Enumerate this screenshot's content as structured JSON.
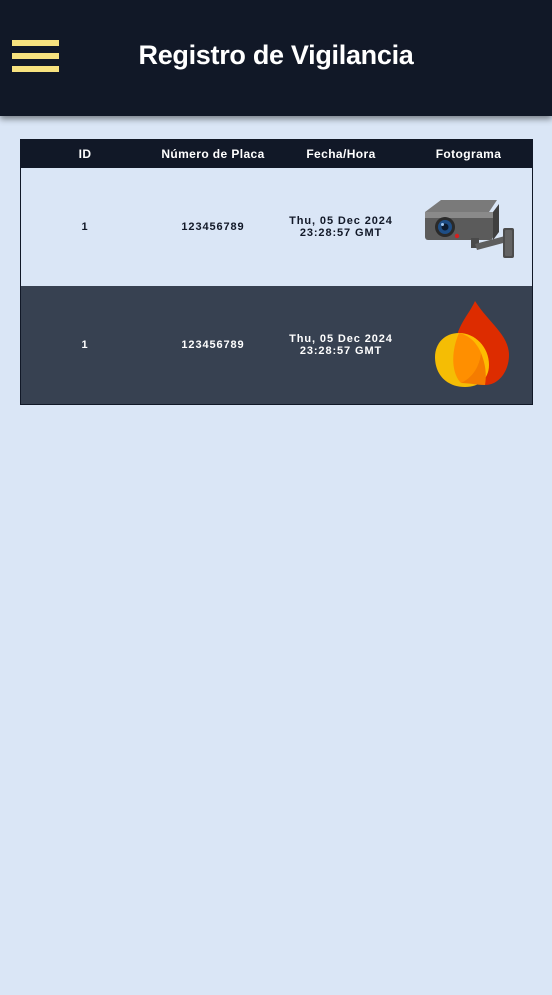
{
  "header": {
    "title": "Registro de Vigilancia",
    "menu_icon": "hamburger-menu-icon",
    "accent_color": "#f7e27f",
    "background_color": "#111827"
  },
  "table": {
    "columns": [
      "ID",
      "Número de Placa",
      "Fecha/Hora",
      "Fotograma"
    ],
    "rows": [
      {
        "id": "1",
        "plate": "123456789",
        "date_line1": "Thu, 05 Dec 2024",
        "date_line2": "23:28:57 GMT",
        "frame_image": "security-camera-image"
      },
      {
        "id": "1",
        "plate": "123456789",
        "date_line1": "Thu, 05 Dec 2024",
        "date_line2": "23:28:57 GMT",
        "frame_image": "flame-logo-image"
      }
    ]
  },
  "colors": {
    "page_background": "#dae6f6",
    "row_dark": "#374151",
    "header_row": "#111827"
  }
}
